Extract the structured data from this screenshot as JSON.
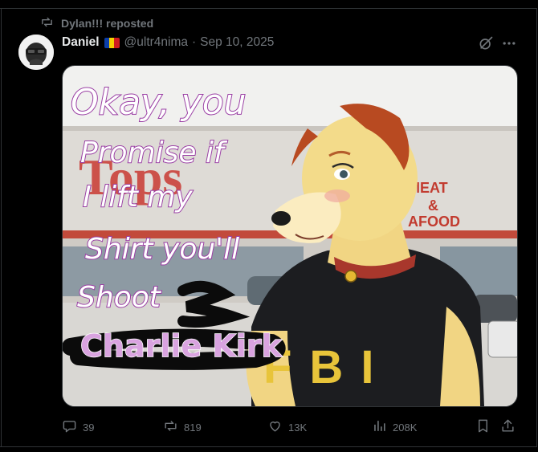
{
  "repost": {
    "label": "Dylan!!! reposted",
    "icon": "repost-icon"
  },
  "tweet": {
    "display_name": "Daniel",
    "flag_colors": [
      "#0b3ea8",
      "#f5d000",
      "#d01c1f"
    ],
    "handle": "@ultr4nima",
    "separator": "·",
    "date": "Sep 10, 2025"
  },
  "image_text": {
    "speech_line_1": "Okay, you",
    "speech_line_2": "Promise if",
    "speech_line_3": "I lift my",
    "speech_line_4": "Shirt you'll",
    "speech_line_5": "Shoot",
    "caption": "Charlie Kirk",
    "shirt_text": "FBI",
    "store_sign": "Tops",
    "store_sign_right_1": "MEAT",
    "store_sign_right_2": "&",
    "store_sign_right_3": "AFOOD"
  },
  "actions": {
    "replies": "39",
    "reposts": "819",
    "likes": "13K",
    "views": "208K"
  },
  "colors": {
    "background": "#000000",
    "text": "#e7e9ea",
    "muted": "#71767b",
    "border": "#2f3336"
  }
}
